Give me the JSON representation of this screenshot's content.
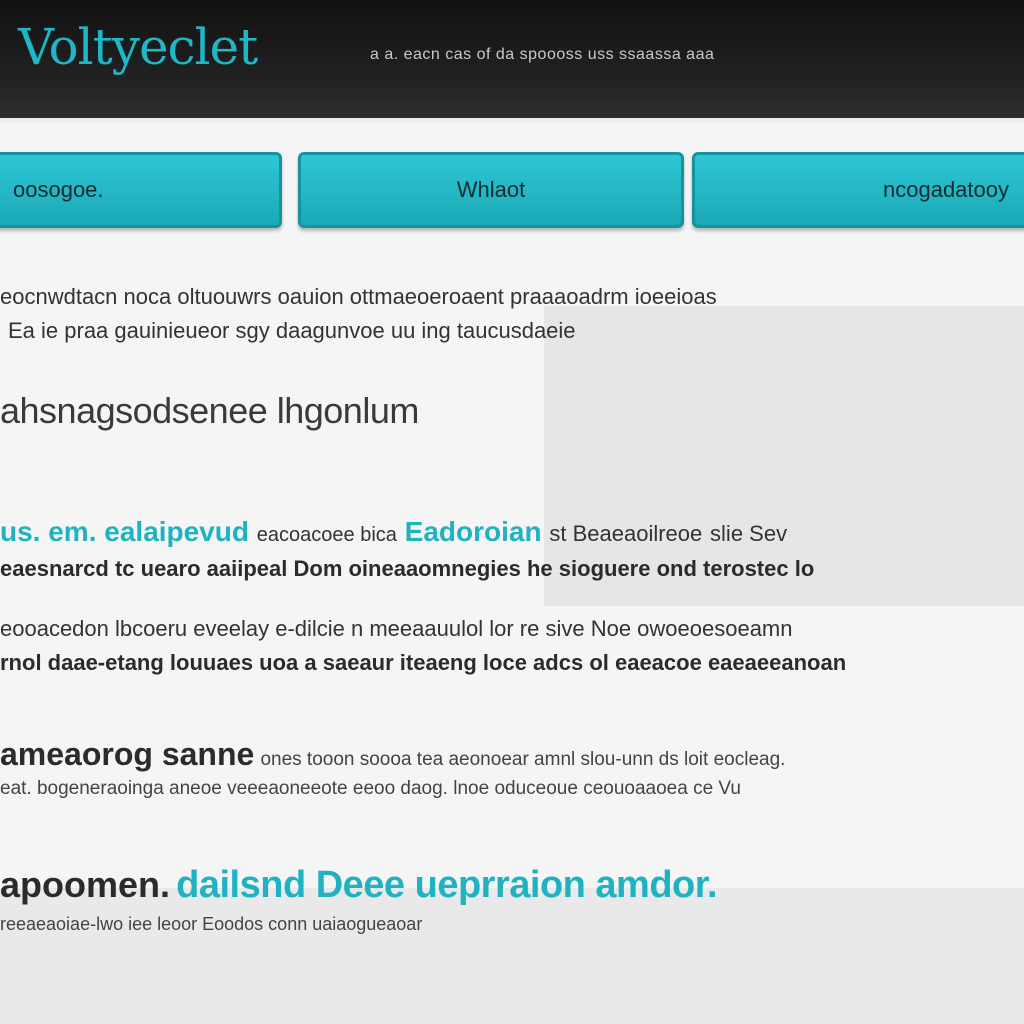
{
  "header": {
    "logo": "Voltyeclet",
    "tagline": "a a. eacn cas of da spoooss uss ssaassa aaa"
  },
  "nav": [
    {
      "label": "oosogoe."
    },
    {
      "label": "Whlaot"
    },
    {
      "label": "ncogadatooy"
    }
  ],
  "intro": {
    "line1": "eocnwdtacn noca oltuouwrs oauion ottmaeoeroaent praaaoadrm ioeeioas",
    "line2": "Ea ie praa gauinieueor sgy daagunvoe uu ing taucusdaeie"
  },
  "heading1": "ahsnagsodsenee lhgonlum",
  "section1": {
    "lead_a": "us. em.",
    "lead_b": "ealaipevud",
    "lead_c": "eacoacoee bica",
    "lead_d": "Eadoroian",
    "lead_e": "st Beaeaoilreoe",
    "lead_f": "slie Sev",
    "line2": "eaesnarcd tc uearo aaiipeal Dom oineaaomnegies he sioguere ond terostec lo"
  },
  "section2": {
    "line1": "eooacedon lbcoeru eveelay e-dilcie n meeaauulol lor re sive Noe owoeoesoeamn",
    "line2": "rnol daae-etang louuaes uoa a saeaur iteaeng loce adcs ol eaeacoe eaeaeeanoan"
  },
  "section3": {
    "lead": "ameaorog sanne",
    "line1_rest": "ones tooon soooa tea aeonoear amnl slou-unn ds loit eocleag.",
    "line2": "eat. bogeneraoinga aneoe veeeaoneeote eeoo daog. lnoe oduceoue ceouoaaoea ce Vu"
  },
  "section4": {
    "lead": "apoomen.",
    "accent": "dailsnd Deee ueprraion amdor.",
    "line": "reeaeaoiae-lwo iee leoor Eoodos conn uaiaogueaoar"
  }
}
